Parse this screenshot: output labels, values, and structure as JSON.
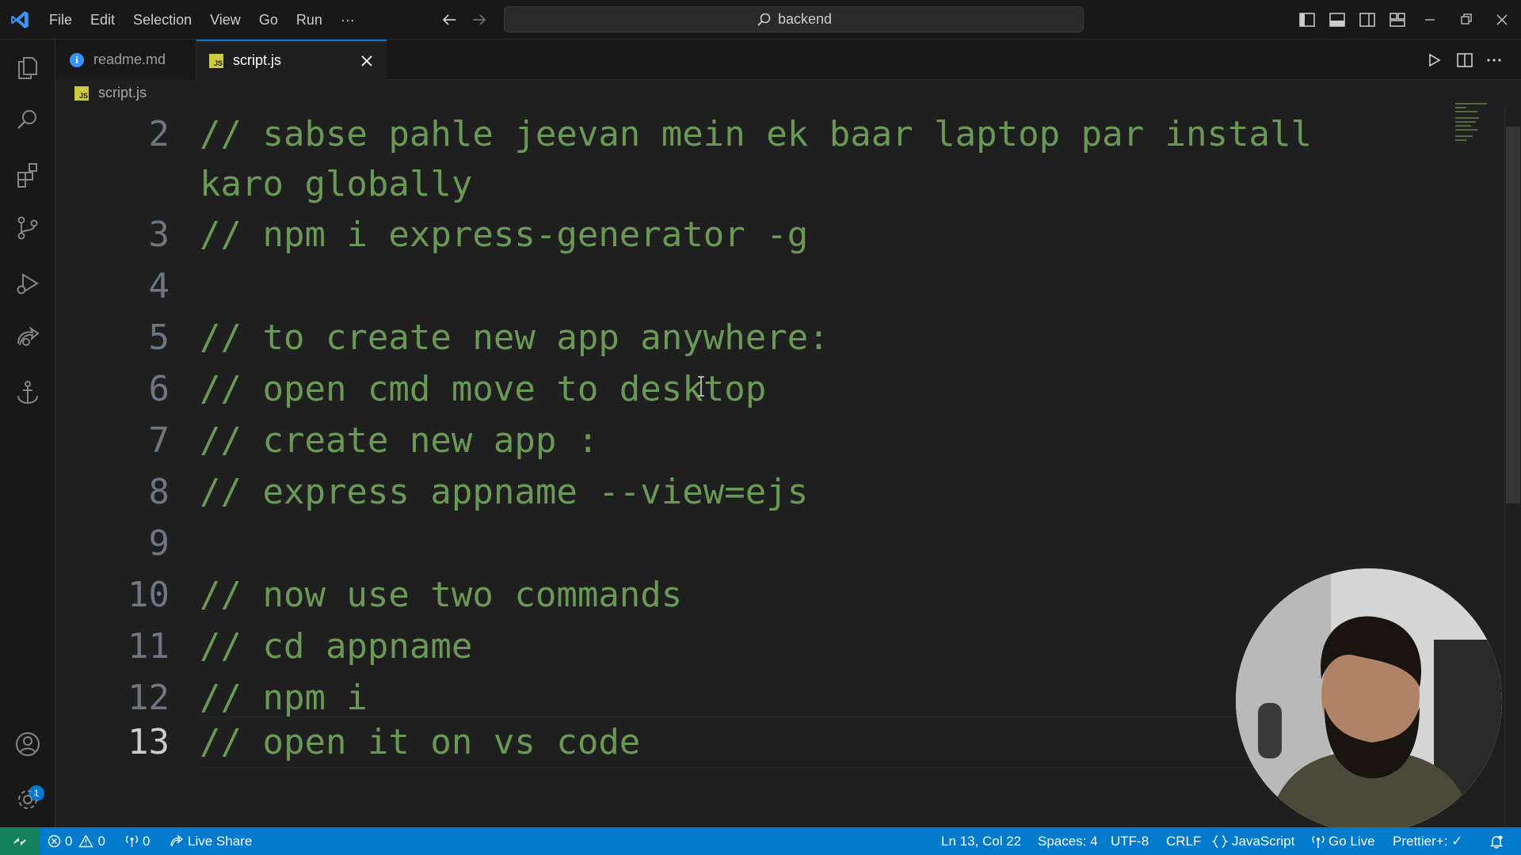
{
  "menu": [
    "File",
    "Edit",
    "Selection",
    "View",
    "Go",
    "Run",
    "···"
  ],
  "command_center": {
    "text": "backend",
    "icon": "search-icon"
  },
  "tabs": [
    {
      "label": "readme.md",
      "icon": "info-icon",
      "active": false
    },
    {
      "label": "script.js",
      "icon": "js-file-icon",
      "active": true
    }
  ],
  "js_icon_text": "JS",
  "info_icon_text": "i",
  "breadcrumb": {
    "file": "script.js"
  },
  "editor": {
    "lines": [
      {
        "number": "2",
        "text": "// sabse pahle jeevan mein ek baar laptop par install"
      },
      {
        "number": "",
        "text": "karo globally"
      },
      {
        "number": "3",
        "text": "// npm i express-generator -g"
      },
      {
        "number": "4",
        "text": ""
      },
      {
        "number": "5",
        "text": "// to create new app anywhere:"
      },
      {
        "number": "6",
        "text": "// open cmd move to desktop"
      },
      {
        "number": "7",
        "text": "// create new app :"
      },
      {
        "number": "8",
        "text": "// express appname --view=ejs"
      },
      {
        "number": "9",
        "text": ""
      },
      {
        "number": "10",
        "text": "// now use two commands"
      },
      {
        "number": "11",
        "text": "// cd appname"
      },
      {
        "number": "12",
        "text": "// npm i"
      },
      {
        "number": "13",
        "text": "// open it on vs code"
      }
    ],
    "current_line": "13"
  },
  "activity_badge": "1",
  "status": {
    "errors": "0",
    "warnings": "0",
    "ports": "0",
    "live_share": "Live Share",
    "position": "Ln 13, Col 22",
    "spaces": "Spaces: 4",
    "encoding": "UTF-8",
    "eol": "CRLF",
    "language": "JavaScript",
    "go_live": "Go Live",
    "prettier": "Prettier+: ✓"
  },
  "colors": {
    "status_bar": "#007acc",
    "remote": "#16825d",
    "comment": "#6a9955",
    "accent": "#0078d4"
  }
}
